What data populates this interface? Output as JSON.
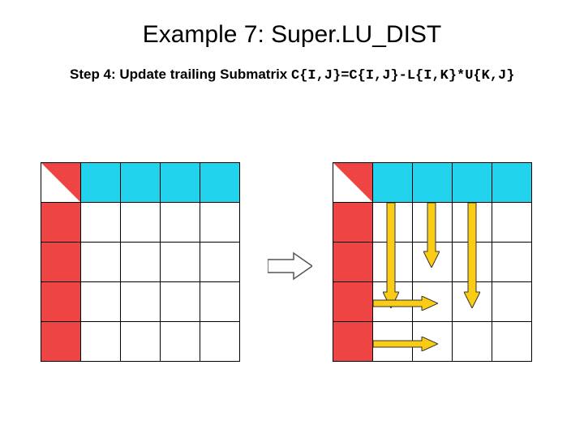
{
  "title": "Example 7: Super.LU_DIST",
  "subtitle_text": "Step 4: Update trailing Submatrix ",
  "subtitle_formula": "C{I,J}=C{I,J}-L{I,K}*U{K,J}",
  "grid": {
    "rows": 5,
    "cols": 5,
    "pivot_cell": [
      0,
      0
    ],
    "cyan_cells": [
      [
        0,
        1
      ],
      [
        0,
        2
      ],
      [
        0,
        3
      ],
      [
        0,
        4
      ]
    ],
    "red_cells": [
      [
        1,
        0
      ],
      [
        2,
        0
      ],
      [
        3,
        0
      ],
      [
        4,
        0
      ]
    ]
  },
  "arrows_right_grid": [
    {
      "type": "down",
      "col": 1,
      "to_row": 3
    },
    {
      "type": "down",
      "col": 2,
      "to_row": 2
    },
    {
      "type": "down",
      "col": 3,
      "to_row": 3
    },
    {
      "type": "right",
      "row": 3,
      "to_col": 2
    },
    {
      "type": "right",
      "row": 4,
      "to_col": 2
    }
  ],
  "colors": {
    "cyan": "#22d3ee",
    "red": "#ef4444",
    "yellow": "#facc15"
  }
}
